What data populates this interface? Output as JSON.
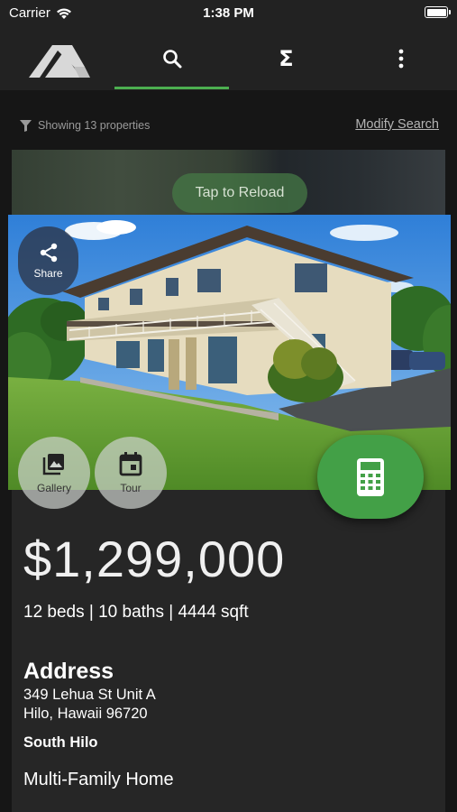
{
  "status_bar": {
    "carrier": "Carrier",
    "time": "1:38 PM",
    "battery_level": 1.0
  },
  "nav": {
    "logo": "mountain-logo",
    "tabs": [
      {
        "icon": "search-icon",
        "active": true
      },
      {
        "icon": "sigma-icon",
        "glyph": "Σ",
        "active": false
      },
      {
        "icon": "more-vertical-icon",
        "active": false
      }
    ],
    "accent_color": "#4caf50"
  },
  "filter": {
    "icon": "filter-icon",
    "text": "Showing 13 properties",
    "modify_label": "Modify Search"
  },
  "reload": {
    "label": "Tap to Reload"
  },
  "actions": {
    "share": {
      "label": "Share",
      "icon": "share-icon"
    },
    "gallery": {
      "label": "Gallery",
      "icon": "gallery-icon"
    },
    "tour": {
      "label": "Tour",
      "icon": "calendar-icon"
    },
    "calculator": {
      "icon": "calculator-icon",
      "color": "#43a047"
    }
  },
  "listing": {
    "price": "$1,299,000",
    "specs": "12 beds | 10 baths | 4444 sqft",
    "address_heading": "Address",
    "address_line1": "349 Lehua St Unit A",
    "address_line2": "Hilo, Hawaii 96720",
    "district": "South Hilo",
    "property_type": "Multi-Family Home"
  }
}
